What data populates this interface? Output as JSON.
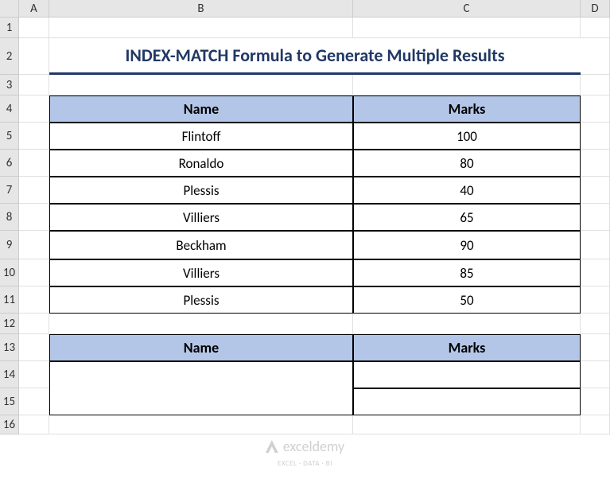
{
  "columns": [
    "A",
    "B",
    "C",
    "D"
  ],
  "rows": [
    "1",
    "2",
    "3",
    "4",
    "5",
    "6",
    "7",
    "8",
    "9",
    "10",
    "11",
    "12",
    "13",
    "14",
    "15",
    "16"
  ],
  "title": "INDEX-MATCH Formula to Generate Multiple Results",
  "table1": {
    "headers": {
      "name": "Name",
      "marks": "Marks"
    },
    "data": [
      {
        "name": "Flintoff",
        "marks": "100"
      },
      {
        "name": "Ronaldo",
        "marks": "80"
      },
      {
        "name": "Plessis",
        "marks": "40"
      },
      {
        "name": "Villiers",
        "marks": "65"
      },
      {
        "name": "Beckham",
        "marks": "90"
      },
      {
        "name": "Villiers",
        "marks": "85"
      },
      {
        "name": "Plessis",
        "marks": "50"
      }
    ]
  },
  "table2": {
    "headers": {
      "name": "Name",
      "marks": "Marks"
    }
  },
  "watermark": {
    "main": "exceldemy",
    "sub": "EXCEL · DATA · BI"
  },
  "chart_data": {
    "type": "table",
    "title": "INDEX-MATCH Formula to Generate Multiple Results",
    "columns": [
      "Name",
      "Marks"
    ],
    "rows": [
      [
        "Flintoff",
        100
      ],
      [
        "Ronaldo",
        80
      ],
      [
        "Plessis",
        40
      ],
      [
        "Villiers",
        65
      ],
      [
        "Beckham",
        90
      ],
      [
        "Villiers",
        85
      ],
      [
        "Plessis",
        50
      ]
    ]
  }
}
